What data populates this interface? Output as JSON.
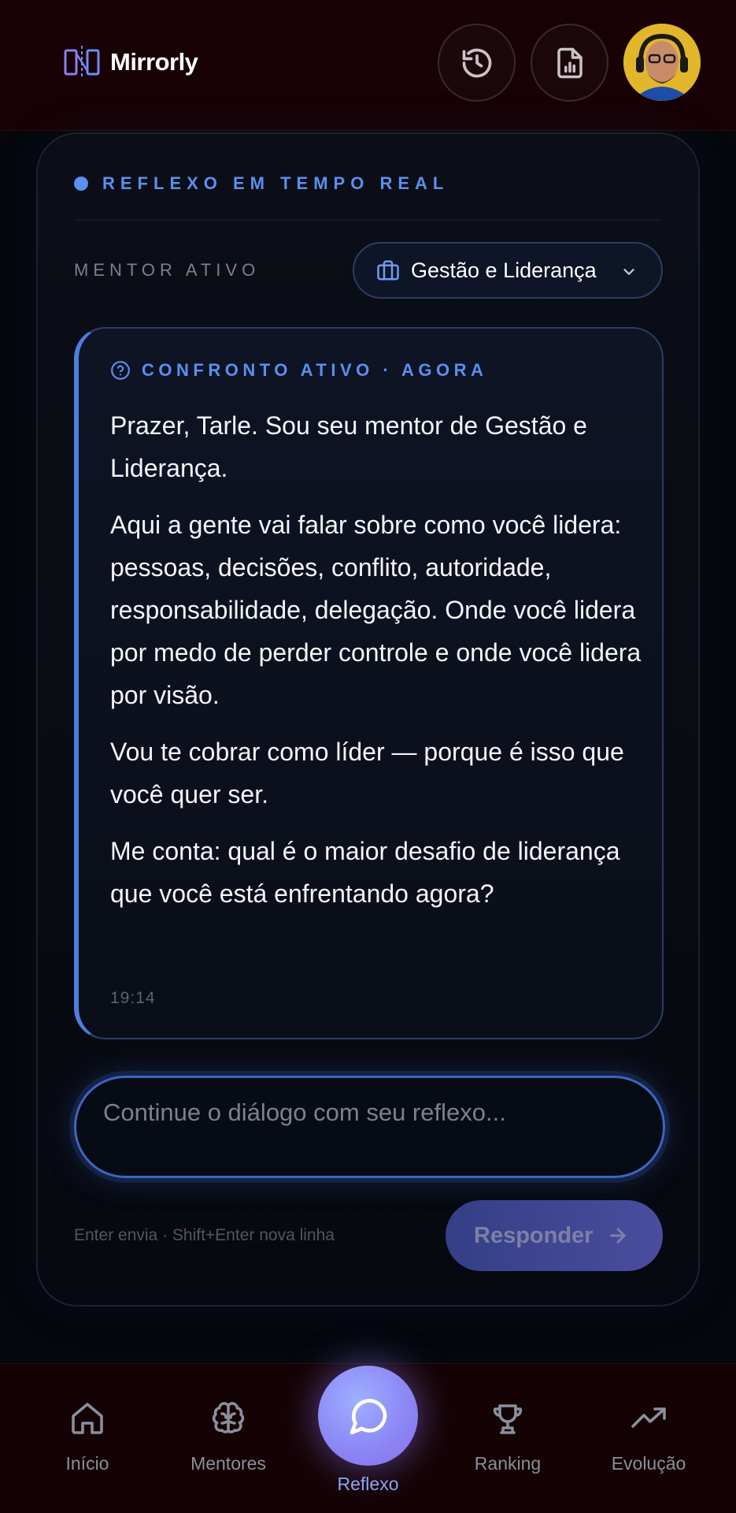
{
  "header": {
    "app_name": "Mirrorly",
    "icons": {
      "logo": "mirror-logo-icon",
      "history": "history-icon",
      "report": "report-chart-icon",
      "avatar": "user-avatar"
    }
  },
  "card": {
    "live_label": "REFLEXO EM TEMPO REAL",
    "mentor_label": "MENTOR ATIVO",
    "mentor_select": {
      "value": "Gestão e Liderança",
      "icon": "briefcase-icon"
    }
  },
  "message": {
    "header": "CONFRONTO ATIVO · AGORA",
    "paragraphs": [
      "Prazer, Tarle. Sou seu mentor de Gestão e Liderança.",
      "Aqui a gente vai falar sobre como você lidera: pessoas, decisões, conflito, autoridade, responsabilidade, delegação. Onde você lidera por medo de perder controle e onde você lidera por visão.",
      "Vou te cobrar como líder — porque é isso que você quer ser.",
      "Me conta: qual é o maior desafio de liderança que você está enfrentando agora?"
    ],
    "time": "19:14"
  },
  "composer": {
    "placeholder": "Continue o diálogo com seu reflexo...",
    "value": "",
    "hint": "Enter envia · Shift+Enter nova linha",
    "reply_label": "Responder"
  },
  "bottom_nav": {
    "items": [
      {
        "label": "Início",
        "icon": "home-icon"
      },
      {
        "label": "Mentores",
        "icon": "brain-icon"
      },
      {
        "label": "Reflexo",
        "icon": "chat-bubble-icon",
        "active": true
      },
      {
        "label": "Ranking",
        "icon": "trophy-icon"
      },
      {
        "label": "Evolução",
        "icon": "trending-up-icon"
      }
    ]
  },
  "colors": {
    "accent": "#5b8ff0",
    "header_bg": "#180205",
    "nav_active": "#8fa4f0"
  }
}
